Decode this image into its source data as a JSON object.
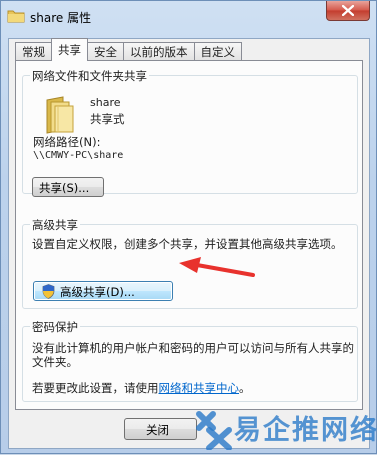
{
  "window": {
    "title": "share 属性"
  },
  "tabs": [
    {
      "label": "常规",
      "active": false
    },
    {
      "label": "共享",
      "active": true
    },
    {
      "label": "安全",
      "active": false
    },
    {
      "label": "以前的版本",
      "active": false
    },
    {
      "label": "自定义",
      "active": false
    }
  ],
  "network_share": {
    "group_title": "网络文件和文件夹共享",
    "folder_name": "share",
    "share_status": "共享式",
    "path_label": "网络路径(N):",
    "path_value": "\\\\CMWY-PC\\share",
    "share_button": "共享(S)..."
  },
  "advanced_sharing": {
    "group_title": "高级共享",
    "description": "设置自定义权限，创建多个共享，并设置其他高级共享选项。",
    "button": "高级共享(D)..."
  },
  "password_protection": {
    "group_title": "密码保护",
    "description": "没有此计算机的用户帐户和密码的用户可以访问与所有人共享的文件夹。",
    "change_prefix": "若要更改此设置，请使用",
    "change_link": "网络和共享中心",
    "change_suffix": "。"
  },
  "footer": {
    "close_button": "关闭"
  },
  "watermark": {
    "text": "易企推网络"
  },
  "colors": {
    "link": "#0066cc",
    "arrow": "#e8322d",
    "watermark": "#2878c8"
  }
}
